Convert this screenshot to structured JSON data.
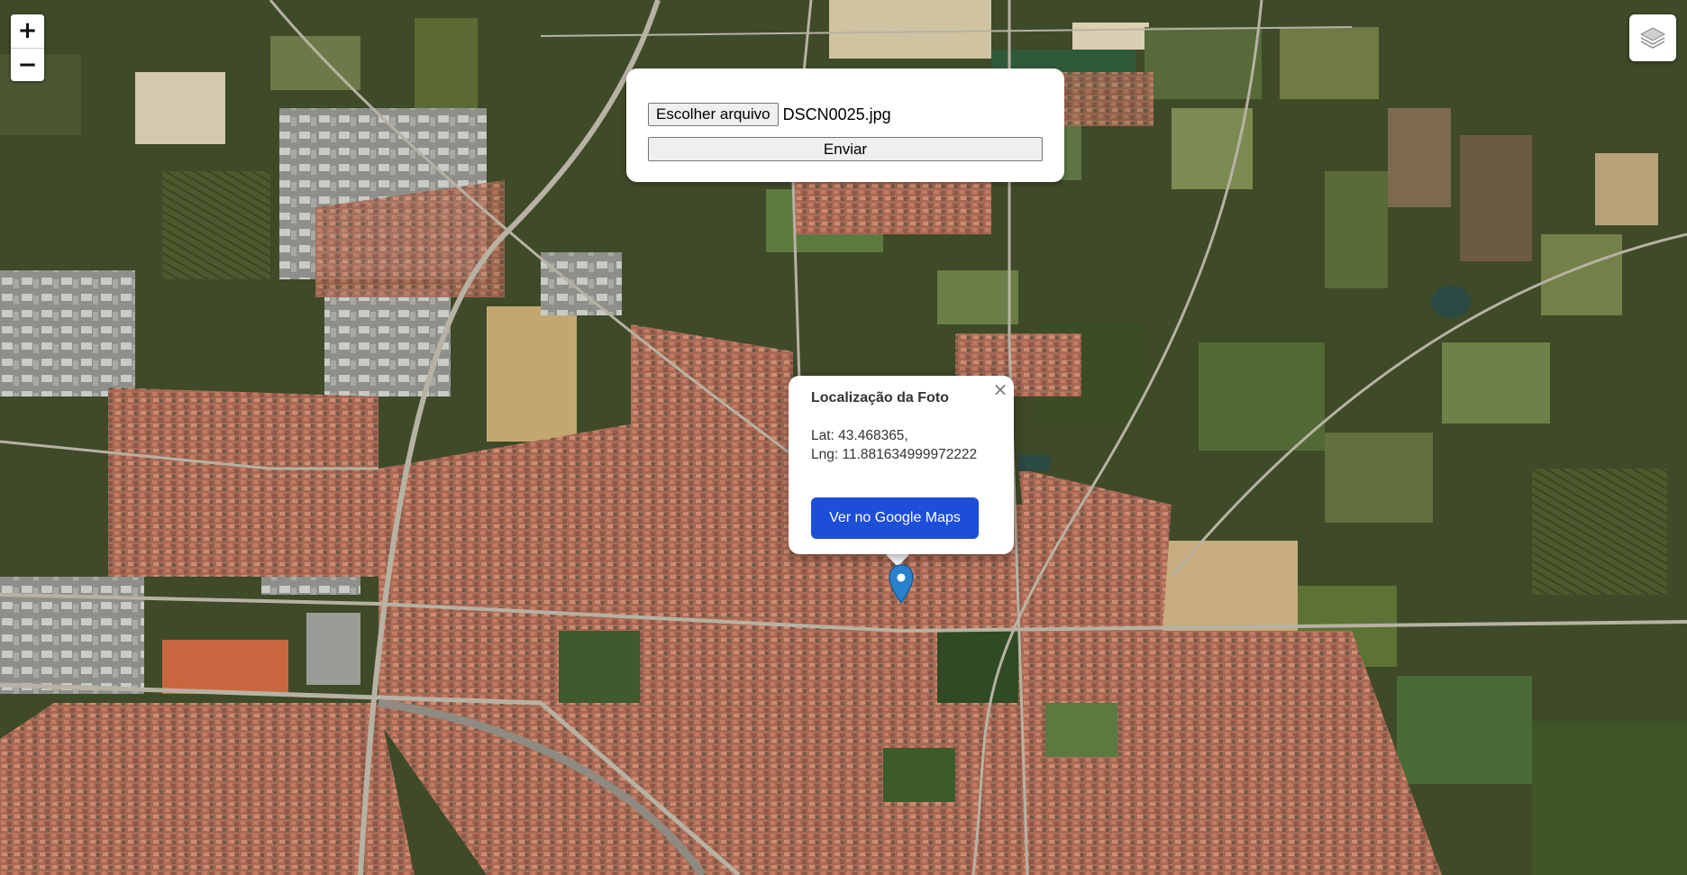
{
  "map": {
    "zoom_in_label": "+",
    "zoom_out_label": "−",
    "layers_icon": "layers-icon",
    "colors": {
      "field_dark": "#3c4a26",
      "field_light": "#8f8d5a",
      "urban_roof": "#b26a55",
      "road": "#b9b3a4",
      "accent_button": "#1c4ed8",
      "marker": "#2a81cb"
    }
  },
  "upload": {
    "choose_file_label": "Escolher arquivo",
    "file_name": "DSCN0025.jpg",
    "submit_label": "Enviar"
  },
  "popup": {
    "title": "Localização da Foto",
    "lat_line": "Lat: 43.468365,",
    "lng_line": "Lng: 11.881634999972222",
    "button_label": "Ver no Google Maps",
    "close_label": "×"
  },
  "marker": {
    "icon": "map-pin-icon"
  }
}
